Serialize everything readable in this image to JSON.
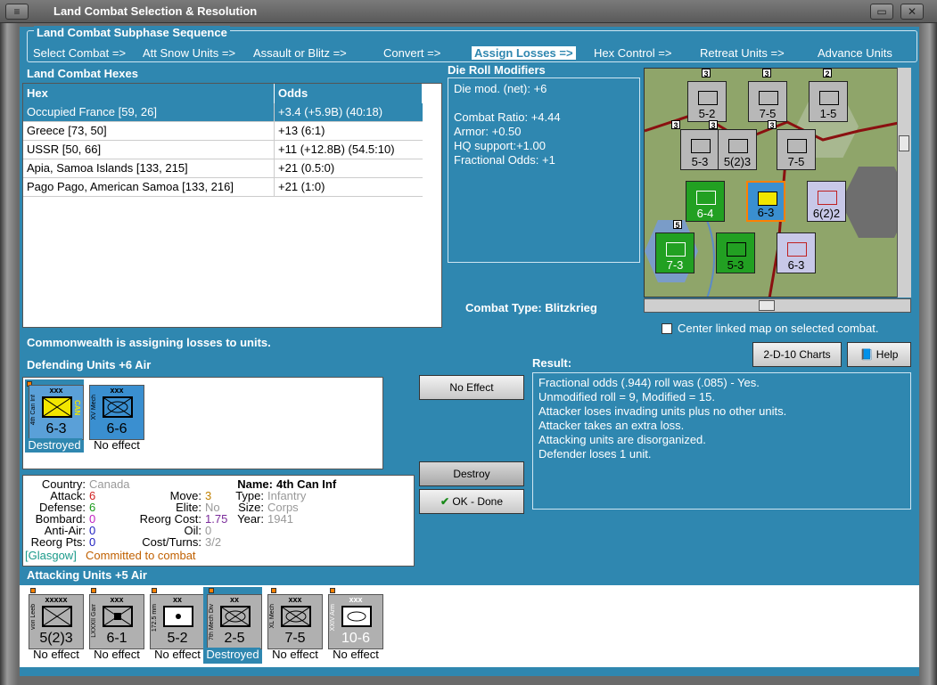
{
  "window": {
    "title": "Land Combat Selection & Resolution"
  },
  "subphase": {
    "title": "Land Combat Subphase Sequence",
    "steps": [
      "Select Combat =>",
      "Att Snow Units =>",
      "Assault or Blitz =>",
      "Convert =>",
      "Assign Losses =>",
      "Hex Control =>",
      "Retreat Units =>",
      "Advance Units"
    ],
    "active_step": "Assign Losses =>"
  },
  "hexes": {
    "title": "Land Combat Hexes",
    "columns": [
      "Hex",
      "Odds"
    ],
    "rows": [
      {
        "hex": "Occupied France [59, 26]",
        "odds": "+3.4 (+5.9B) (40:18)"
      },
      {
        "hex": "Greece [73, 50]",
        "odds": "+13 (6:1)"
      },
      {
        "hex": "USSR [50, 66]",
        "odds": "+11 (+12.8B) (54.5:10)"
      },
      {
        "hex": "Apia, Samoa Islands [133, 215]",
        "odds": "+21 (0.5:0)"
      },
      {
        "hex": "Pago Pago, American Samoa [133, 216]",
        "odds": "+21 (1:0)"
      }
    ]
  },
  "modifiers": {
    "title": "Die Roll Modifiers",
    "lines": [
      "Die mod. (net): +6",
      "",
      "Combat Ratio: +4.44",
      "Armor: +0.50",
      "HQ support:+1.00",
      "Fractional Odds: +1"
    ]
  },
  "combat_type": {
    "label": "Combat Type:",
    "value": "Blitzkrieg"
  },
  "center_map_label": "Center linked map on selected combat.",
  "assigning_msg": "Commonwealth is assigning losses to units.",
  "defending": {
    "title": "Defending Units +6 Air",
    "units": [
      {
        "name": "4th Can Inf",
        "size": "xxx",
        "strength": "6-3",
        "status": "Destroyed",
        "tag": "CAN",
        "color": "#5aa0d8",
        "symbol_color": "#f2e600"
      },
      {
        "name": "XV Mech",
        "size": "xxx",
        "strength": "6-6",
        "status": "No effect",
        "color": "#3a8fd0",
        "symbol_color": "#3a8fd0"
      }
    ]
  },
  "buttons": {
    "no_effect": "No Effect",
    "destroy": "Destroy",
    "ok_done": "OK - Done",
    "charts": "2-D-10 Charts",
    "help": "Help"
  },
  "result": {
    "title": "Result:",
    "lines": [
      "Fractional odds (.944) roll was (.085)  - Yes.",
      "Unmodified roll = 9, Modified = 15.",
      "Attacker loses invading units plus no other units.",
      "Attacker takes an extra loss.",
      "Attacking units are disorganized.",
      "Defender loses 1 unit."
    ]
  },
  "unit_info": {
    "country_label": "Country:",
    "country": "Canada",
    "attack_label": "Attack:",
    "attack": "6",
    "defense_label": "Defense:",
    "defense": "6",
    "bombard_label": "Bombard:",
    "bombard": "0",
    "antiair_label": "Anti-Air:",
    "antiair": "0",
    "reorgpts_label": "Reorg Pts:",
    "reorgpts": "0",
    "move_label": "Move:",
    "move": "3",
    "elite_label": "Elite:",
    "elite": "No",
    "reorgcost_label": "Reorg Cost:",
    "reorgcost": "1.75",
    "oil_label": "Oil:",
    "oil": "0",
    "costturns_label": "Cost/Turns:",
    "costturns": "3/2",
    "name_label": "Name:",
    "name": "4th Can Inf",
    "type_label": "Type:",
    "type": "Infantry",
    "size_label": "Size:",
    "size": "Corps",
    "year_label": "Year:",
    "year": "1941",
    "location": "[Glasgow]",
    "status": "Committed to combat"
  },
  "attacking": {
    "title": "Attacking Units +5 Air",
    "units": [
      {
        "name": "von Leeb",
        "size": "xxxxx",
        "strength": "5(2)3",
        "status": "No effect"
      },
      {
        "name": "LXXXII Garr",
        "size": "xxx",
        "strength": "6-1",
        "status": "No effect"
      },
      {
        "name": "172.5 mm",
        "size": "xx",
        "strength": "5-2",
        "status": "No effect"
      },
      {
        "name": "7th Mech Div",
        "size": "xx",
        "strength": "2-5",
        "status": "Destroyed"
      },
      {
        "name": "XL Mech",
        "size": "xxx",
        "strength": "7-5",
        "status": "No effect"
      },
      {
        "name": "XXIV Arm",
        "size": "xxx",
        "strength": "10-6",
        "status": "No effect"
      }
    ]
  },
  "map": {
    "units": [
      {
        "label": "5-2",
        "stack": "3",
        "color": "#b8b8b8"
      },
      {
        "label": "7-5",
        "stack": "3",
        "color": "#b8b8b8"
      },
      {
        "label": "1-5",
        "stack": "2",
        "color": "#b8b8b8"
      },
      {
        "label": "5-3",
        "stack": "3",
        "color": "#b8b8b8"
      },
      {
        "label": "5(2)3",
        "stack": "3",
        "color": "#b8b8b8"
      },
      {
        "label": "7-5",
        "stack": "3",
        "color": "#b8b8b8"
      },
      {
        "label": "6-4",
        "stack": "",
        "color": "#22a022"
      },
      {
        "label": "6-3",
        "stack": "",
        "color": "#3a8fd0"
      },
      {
        "label": "6(2)2",
        "stack": "",
        "color": "#c8c8e8"
      },
      {
        "label": "7-3",
        "stack": "5",
        "color": "#22a022"
      },
      {
        "label": "5-3",
        "stack": "",
        "color": "#22a022"
      },
      {
        "label": "6-3",
        "stack": "",
        "color": "#c8c8e8"
      }
    ]
  }
}
